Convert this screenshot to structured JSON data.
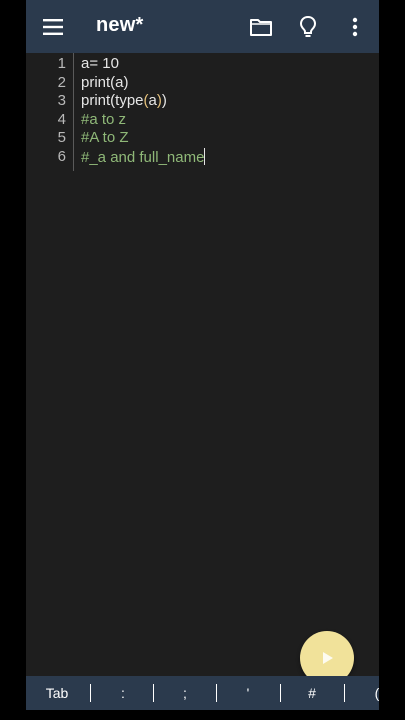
{
  "app": {
    "title": "new*"
  },
  "toolbar": {
    "menu_icon": "hamburger-menu-icon",
    "folder_icon": "folder-icon",
    "bulb_icon": "lightbulb-icon",
    "more_icon": "more-vert-icon"
  },
  "editor": {
    "line_numbers": [
      "1",
      "2",
      "3",
      "4",
      "5",
      "6"
    ],
    "lines": [
      {
        "text": "a= 10"
      },
      {
        "text": "print(a)"
      },
      {
        "prefix": "print(type",
        "paren_open": "(",
        "inner": "a",
        "paren_close": ")",
        "suffix": ")"
      },
      {
        "text": "#a to z"
      },
      {
        "text": "#A to Z"
      },
      {
        "text": "#_a and full_name"
      }
    ]
  },
  "run_button": {
    "icon": "play-icon"
  },
  "keybar": {
    "keys": [
      "Tab",
      ":",
      ";",
      "'",
      "#",
      "("
    ]
  },
  "colors": {
    "toolbar_bg": "#2b3a4d",
    "editor_bg": "#1e1e1e",
    "comment": "#8fb878",
    "paren_highlight": "#e5c17c",
    "run_button": "#f1e29a"
  }
}
